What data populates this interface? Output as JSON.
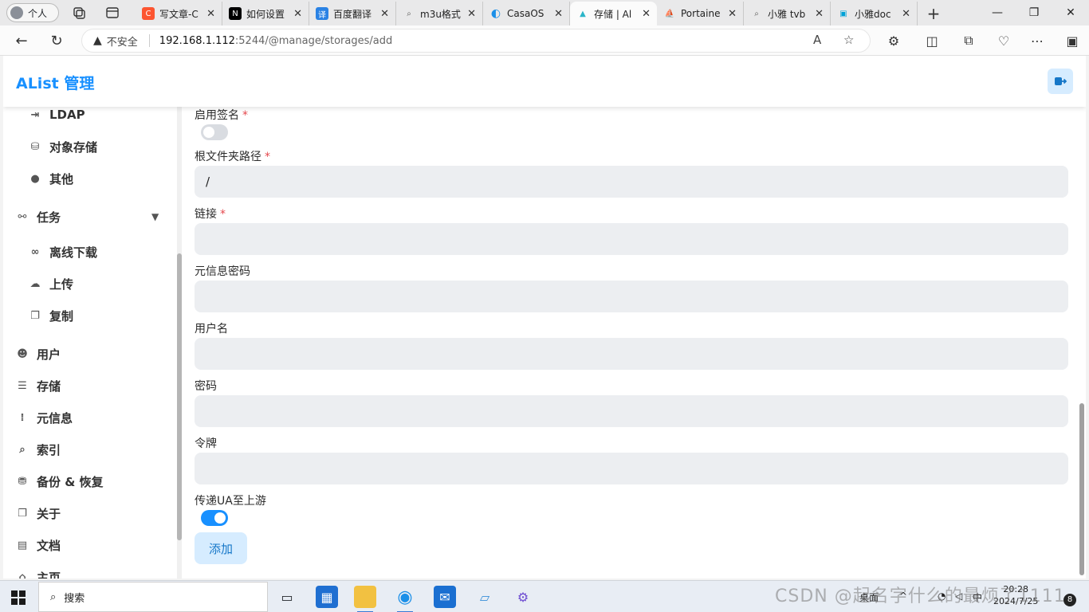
{
  "browser": {
    "profile_label": "个人",
    "tabs": [
      {
        "label": "写文章-C",
        "fav": "C",
        "fav_color": "#fc5531"
      },
      {
        "label": "如何设置",
        "fav": "N",
        "fav_color": "#000000"
      },
      {
        "label": "百度翻译",
        "fav": "译",
        "fav_color": "#2a82e4"
      },
      {
        "label": "m3u格式",
        "fav": "⌕",
        "fav_color": "#ffffff"
      },
      {
        "label": "CasaOS",
        "fav": "◐",
        "fav_color": "#1a8fe8"
      },
      {
        "label": "存储 | Al",
        "fav": "▲",
        "fav_color": "#ffffff"
      },
      {
        "label": "Portaine",
        "fav": "⛵",
        "fav_color": "#ffffff"
      },
      {
        "label": "小雅 tvb",
        "fav": "⌕",
        "fav_color": "#ffffff"
      },
      {
        "label": "小雅doc",
        "fav": "▣",
        "fav_color": "#ffffff"
      }
    ],
    "close_glyph": "✕",
    "new_tab": "+",
    "address": {
      "insecure_label": "不安全",
      "host": "192.168.1.112",
      "path": ":5244/@manage/storages/add"
    }
  },
  "app": {
    "title": "AList 管理"
  },
  "sidebar": {
    "items": [
      {
        "label": "LDAP",
        "icon": "login-icon",
        "glyph": "⇥"
      },
      {
        "label": "对象存储",
        "icon": "bucket-icon",
        "glyph": "⛁"
      },
      {
        "label": "其他",
        "icon": "dots-icon",
        "glyph": "●"
      },
      {
        "label": "任务",
        "icon": "tasks-icon",
        "glyph": "⚯"
      },
      {
        "label": "离线下载",
        "icon": "link-icon",
        "glyph": "∞"
      },
      {
        "label": "上传",
        "icon": "cloud-upload-icon",
        "glyph": "☁"
      },
      {
        "label": "复制",
        "icon": "copy-icon",
        "glyph": "❐"
      },
      {
        "label": "用户",
        "icon": "user-icon",
        "glyph": "☻"
      },
      {
        "label": "存储",
        "icon": "storage-icon",
        "glyph": "☰"
      },
      {
        "label": "元信息",
        "icon": "meta-icon",
        "glyph": "⁞"
      },
      {
        "label": "索引",
        "icon": "search-icon",
        "glyph": "⌕"
      },
      {
        "label": "备份 & 恢复",
        "icon": "database-icon",
        "glyph": "⛃"
      },
      {
        "label": "关于",
        "icon": "copy-icon",
        "glyph": "❐"
      },
      {
        "label": "文档",
        "icon": "document-icon",
        "glyph": "▤"
      },
      {
        "label": "主页",
        "icon": "home-icon",
        "glyph": "⌂"
      }
    ]
  },
  "form": {
    "enable_sign": {
      "label": "启用签名",
      "required": "*",
      "on": false
    },
    "root_path": {
      "label": "根文件夹路径",
      "required": "*",
      "value": "/"
    },
    "link": {
      "label": "链接",
      "required": "*",
      "value": ""
    },
    "meta_password": {
      "label": "元信息密码",
      "value": ""
    },
    "username": {
      "label": "用户名",
      "value": ""
    },
    "password": {
      "label": "密码",
      "value": ""
    },
    "token": {
      "label": "令牌",
      "value": ""
    },
    "pass_ua": {
      "label": "传递UA至上游",
      "on": true
    },
    "submit_label": "添加"
  },
  "taskbar": {
    "search_label": "搜索",
    "tray": {
      "desktop": "桌面",
      "ime": "中"
    },
    "clock": {
      "time": "20:28",
      "date": "2024/7/25"
    },
    "notifications": "8"
  },
  "watermark": "CSDN @起名字什么的最烦了1111"
}
